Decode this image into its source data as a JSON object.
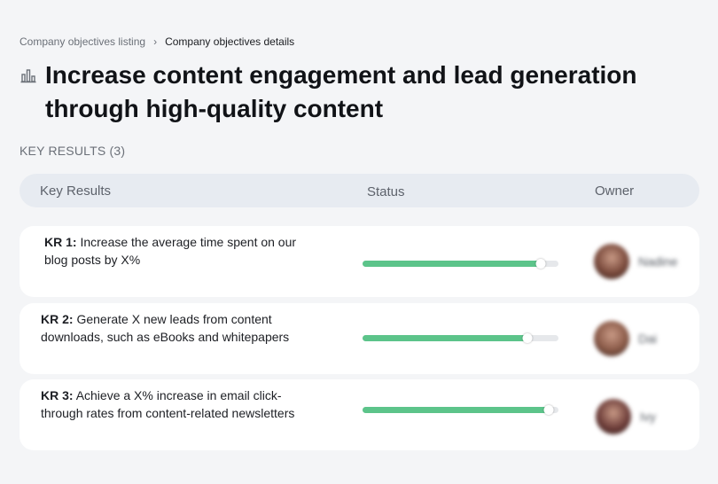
{
  "breadcrumb": {
    "parent": "Company objectives listing",
    "separator": "›",
    "current": "Company objectives details"
  },
  "page": {
    "title": "Increase content engagement and lead generation through high-quality content",
    "icon": "chart-bars-icon"
  },
  "key_results_section": {
    "label": "KEY RESULTS (3)"
  },
  "table": {
    "columns": [
      "Key Results",
      "Status",
      "Owner"
    ],
    "rows": [
      {
        "kr_label": "KR 1:",
        "description": "Increase the average time spent on our blog posts by X%",
        "progress": 0.91,
        "owner_name": "Nadine",
        "avatar_color": "#7a4a3c"
      },
      {
        "kr_label": "KR 2:",
        "description": "Generate X new leads from content downloads, such as eBooks and whitepapers",
        "progress": 0.84,
        "owner_name": "Dai",
        "avatar_color": "#8a5a48"
      },
      {
        "kr_label": "KR 3:",
        "description": "Achieve a X% increase in email click-through rates from content-related newsletters",
        "progress": 0.95,
        "owner_name": "Ivy",
        "avatar_color": "#6e3e3a"
      }
    ]
  },
  "colors": {
    "progress_fill": "#5cc48a",
    "progress_track": "#e6e8eb",
    "header_bg": "#e7ebf1",
    "page_bg": "#f4f5f7"
  }
}
